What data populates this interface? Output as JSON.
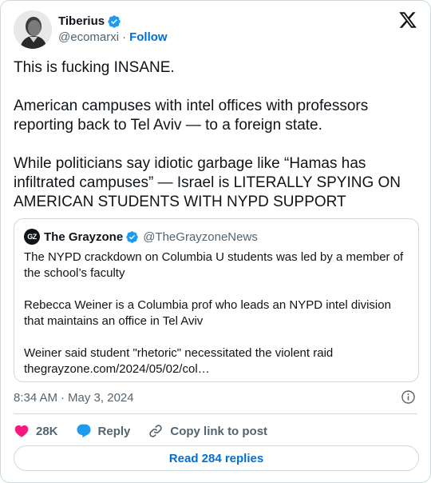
{
  "author": {
    "display_name": "Tiberius",
    "handle": "@ecomarxi",
    "follow_label": "Follow",
    "verified": true
  },
  "tweet": {
    "text": "This is fucking INSANE.\n\nAmerican campuses with intel offices with professors reporting back to Tel Aviv — to a foreign state.\n\nWhile politicians say idiotic garbage like “Hamas has infiltrated campuses” — Israel is LITERALLY SPYING ON AMERICAN STUDENTS WITH NYPD SUPPORT"
  },
  "quote": {
    "avatar_text": "GZ",
    "display_name": "The Grayzone",
    "handle": "@TheGrayzoneNews",
    "verified": true,
    "text": "The NYPD crackdown on Columbia U students was led by a member of the school’s faculty\n\nRebecca Weiner is a Columbia prof who leads an NYPD intel division that maintains an office in Tel Aviv\n\nWeiner said student \"rhetoric\" necessitated the violent raid\nthegrayzone.com/2024/05/02/col…"
  },
  "meta": {
    "time": "8:34 AM",
    "separator": "·",
    "date": "May 3, 2024"
  },
  "actions": {
    "like_count": "28K",
    "reply_label": "Reply",
    "copy_label": "Copy link to post"
  },
  "read_replies_label": "Read 284 replies",
  "colors": {
    "accent": "#1d9bf0",
    "link": "#006fd6",
    "like": "#f91880",
    "text": "#0f1419",
    "secondary": "#536471",
    "border": "#cfd9de"
  }
}
